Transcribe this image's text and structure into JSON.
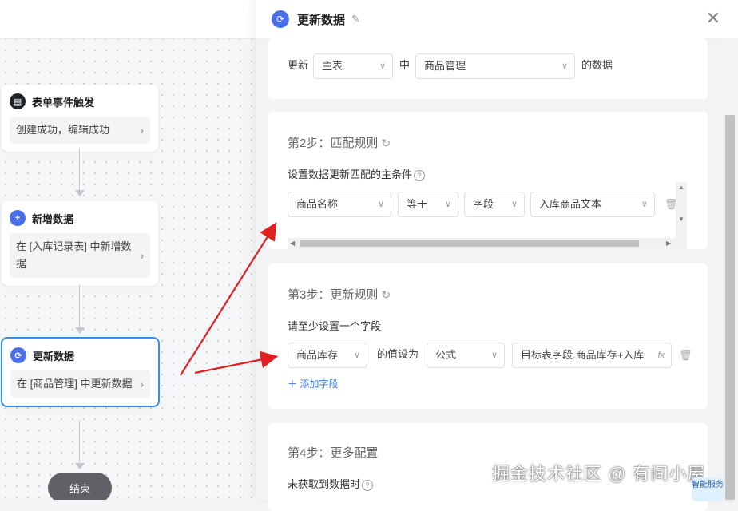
{
  "canvas": {
    "nodes": [
      {
        "title": "表单事件触发",
        "body": "创建成功，编辑成功",
        "icon": "document-icon",
        "color": "#1f2329"
      },
      {
        "title": "新增数据",
        "body": "在 [入库记录表] 中新增数据",
        "icon": "plus-icon",
        "color": "#4a6fe8"
      },
      {
        "title": "更新数据",
        "body": "在 [商品管理] 中更新数据",
        "icon": "sync-icon",
        "color": "#4a6fe8"
      }
    ],
    "end_label": "结束"
  },
  "panel": {
    "title": "更新数据",
    "step1": {
      "update_label": "更新",
      "table_select": "主表",
      "in_label": "中",
      "form_select": "商品管理",
      "suffix": "的数据"
    },
    "step2": {
      "title": "第2步：匹配规则",
      "desc": "设置数据更新匹配的主条件",
      "field": "商品名称",
      "operator": "等于",
      "value_type": "字段",
      "value": "入库商品文本"
    },
    "step3": {
      "title": "第3步：更新规则",
      "desc": "请至少设置一个字段",
      "field": "商品库存",
      "set_label": "的值设为",
      "value_type": "公式",
      "formula": "目标表字段.商品库存+入库",
      "fx": "fx",
      "add_field": "添加字段"
    },
    "step4": {
      "title": "第4步：更多配置",
      "desc": "未获取到数据时"
    }
  },
  "watermark": "掘金技术社区 @ 有间小屋",
  "assistant": "智能服务",
  "colors": {
    "accent": "#3a8ee6",
    "arrow": "#e02020"
  }
}
